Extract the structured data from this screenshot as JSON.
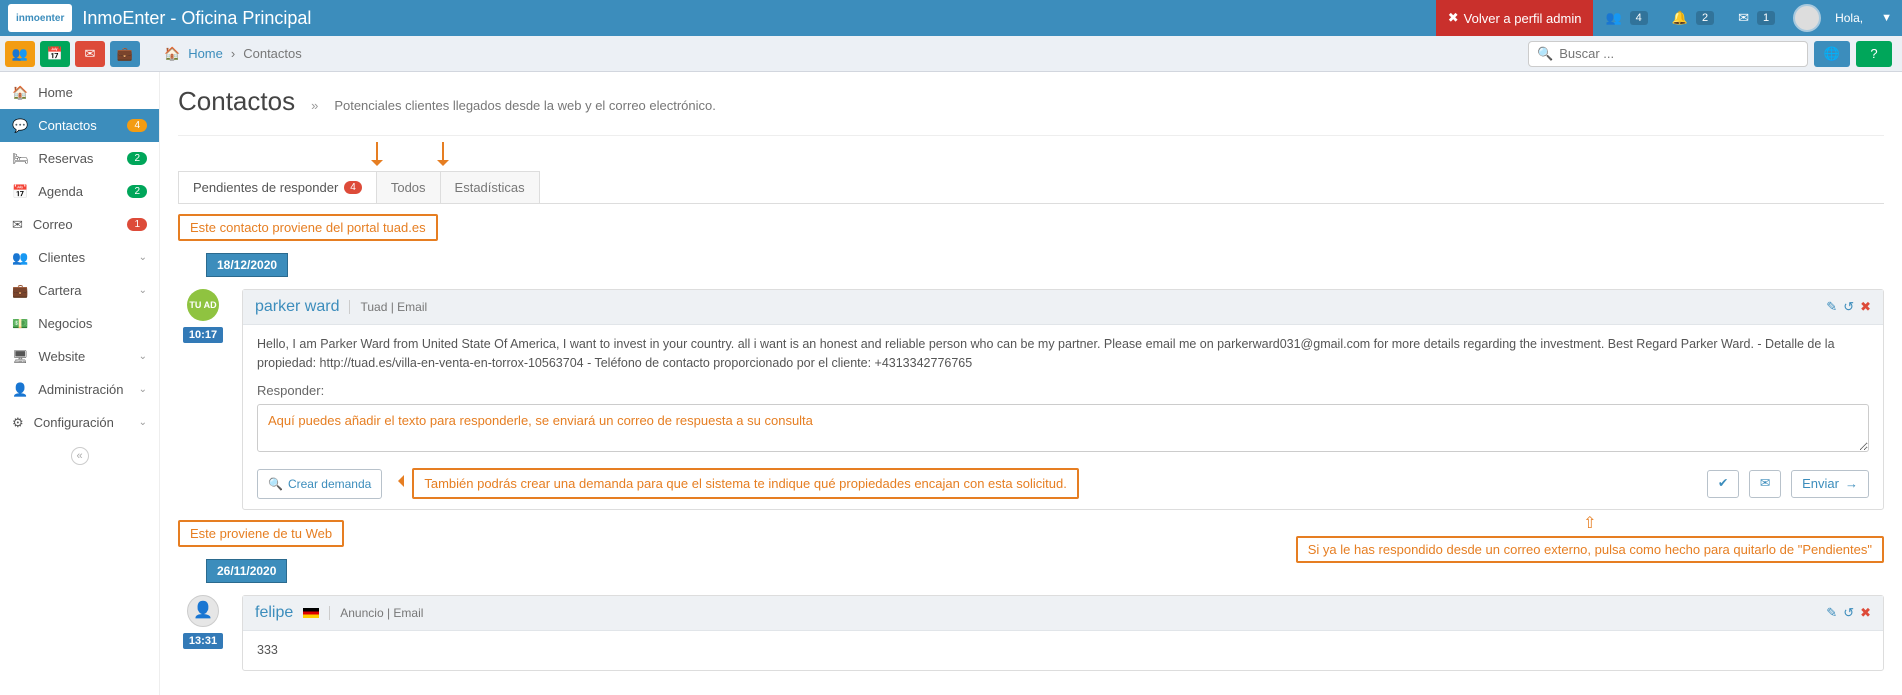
{
  "colors": {
    "primary": "#3c8dbc",
    "danger": "#dd4b39",
    "warn": "#f39c12",
    "ok": "#00a65a",
    "anno": "#e67e22"
  },
  "topbar": {
    "logo_text": "inmoenter",
    "title": "InmoEnter - Oficina Principal",
    "back_admin": "Volver a perfil admin",
    "users_badge": "4",
    "bell_badge": "2",
    "mail_badge": "1",
    "greeting": "Hola,"
  },
  "secbar": {
    "breadcrumb_home": "Home",
    "breadcrumb_current": "Contactos",
    "search_placeholder": "Buscar ..."
  },
  "sidebar": [
    {
      "icon": "home-icon",
      "label": "Home"
    },
    {
      "icon": "chat-icon",
      "label": "Contactos",
      "pill": "4",
      "pillClass": "pill-orange",
      "active": true
    },
    {
      "icon": "bed-icon",
      "label": "Reservas",
      "pill": "2",
      "pillClass": "pill-green"
    },
    {
      "icon": "calendar-icon",
      "label": "Agenda",
      "pill": "2",
      "pillClass": "pill-green"
    },
    {
      "icon": "mail-icon",
      "label": "Correo",
      "pill": "1",
      "pillClass": "pill-red"
    },
    {
      "icon": "users-icon",
      "label": "Clientes",
      "chev": true
    },
    {
      "icon": "case-icon",
      "label": "Cartera",
      "chev": true
    },
    {
      "icon": "money-icon",
      "label": "Negocios"
    },
    {
      "icon": "screen-icon",
      "label": "Website",
      "chev": true
    },
    {
      "icon": "admin-icon",
      "label": "Administración",
      "chev": true
    },
    {
      "icon": "cog-icon",
      "label": "Configuración",
      "chev": true
    }
  ],
  "page": {
    "title": "Contactos",
    "subtitle": "Potenciales clientes llegados desde la web y el correo electrónico."
  },
  "tabs": {
    "pending": "Pendientes de responder",
    "pending_count": "4",
    "all": "Todos",
    "stats": "Estadísticas"
  },
  "annotations": {
    "a1": "Este contacto proviene del portal tuad.es",
    "a2": "Aquí puedes añadir el texto para responderle, se enviará un correo de respuesta a su consulta",
    "a3": "También podrás crear una demanda para que el sistema te indique qué propiedades encajan con esta solicitud.",
    "a4": "Si ya le has respondido desde un correo externo, pulsa como hecho para quitarlo de \"Pendientes\"",
    "a5": "Este proviene de tu Web"
  },
  "card1": {
    "date": "18/12/2020",
    "time": "10:17",
    "origin_logo": "TU AD",
    "name": "parker ward",
    "meta": "Tuad | Email",
    "body": "Hello, I am Parker Ward from United State Of America, I want to invest in your country. all i want is an honest and reliable person who can be my partner. Please email me on parkerward031@gmail.com for more details regarding the investment. Best Regard Parker Ward. - Detalle de la propiedad: http://tuad.es/villa-en-venta-en-torrox-10563704 - Teléfono de contacto proporcionado por el cliente: +4313342776765",
    "respond_label": "Responder:",
    "create_demand": "Crear demanda",
    "send": "Enviar"
  },
  "card2": {
    "date": "26/11/2020",
    "time": "13:31",
    "name": "felipe",
    "meta": "Anuncio | Email",
    "body": "333"
  }
}
